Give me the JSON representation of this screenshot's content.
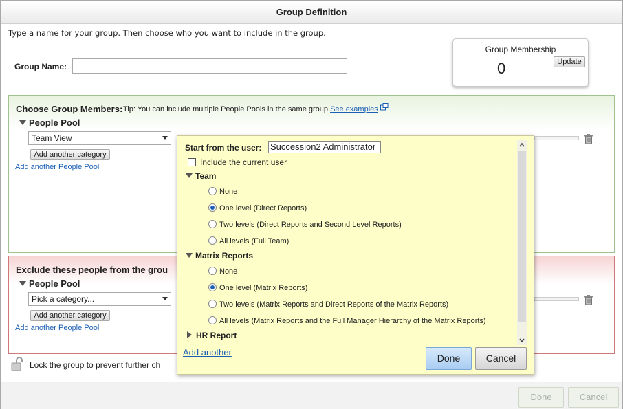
{
  "dialog": {
    "title": "Group Definition"
  },
  "intro": "Type a name for your group. Then choose who you want to include in the group.",
  "group_name": {
    "label": "Group Name:",
    "value": ""
  },
  "membership": {
    "label": "Group Membership",
    "count": "0",
    "update_label": "Update"
  },
  "include": {
    "title": "Choose Group Members:",
    "tip_text": "Tip: You can include multiple People Pools in the same group.",
    "tip_link": "See examples",
    "pool_label": "People Pool",
    "category_value": "Team View",
    "add_category": "Add another category",
    "add_pool": "Add another People Pool"
  },
  "exclude": {
    "title": "Exclude these people from the grou",
    "pool_label": "People Pool",
    "category_value": "Pick a category...",
    "add_category": "Add another category",
    "add_pool": "Add another People Pool"
  },
  "lock_text": "Lock the group to prevent further ch",
  "footer": {
    "done": "Done",
    "cancel": "Cancel"
  },
  "popup": {
    "start_label": "Start from the user:",
    "start_value": "Succession2 Administrator",
    "include_current": "Include the current user",
    "team": {
      "label": "Team",
      "options": [
        "None",
        "One level (Direct Reports)",
        "Two levels (Direct Reports and Second Level Reports)",
        "All levels (Full Team)"
      ],
      "selected": 1
    },
    "matrix": {
      "label": "Matrix Reports",
      "options": [
        "None",
        "One level (Matrix Reports)",
        "Two levels (Matrix Reports and Direct Reports of the Matrix Reports)",
        "All levels (Matrix Reports and the Full Manager Hierarchy of the Matrix Reports)"
      ],
      "selected": 1
    },
    "hr_report": "HR Report",
    "add_another": "Add another",
    "done": "Done",
    "cancel": "Cancel"
  }
}
